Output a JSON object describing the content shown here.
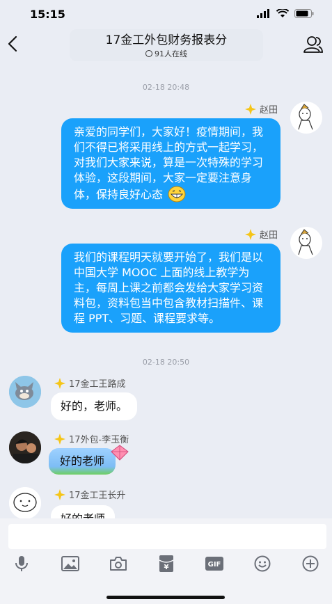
{
  "status_bar": {
    "time": "15:15"
  },
  "header": {
    "title": "17金工外包财务报表分",
    "online": "91人在线"
  },
  "messages": {
    "timestamp_1": "02-18 20:48",
    "timestamp_2": "02-18 20:50",
    "m1": {
      "sender": "赵田",
      "text": "亲爱的同学们，大家好！疫情期间，我们不得已将采用线上的方式一起学习，对我们大家来说，算是一次特殊的学习体验，这段期间，大家一定要注意身体，保持良好心态"
    },
    "m2": {
      "sender": "赵田",
      "text": "我们的课程明天就要开始了，我们是以中国大学 MOOC 上面的线上教学为主，每周上课之前都会发给大家学习资料包，资料包当中包含教材扫描件、课程 PPT、习题、课程要求等。"
    },
    "m3": {
      "sender": "17金工王路成",
      "text": "好的，老师。"
    },
    "m4": {
      "sender": "17外包-李玉衡",
      "text": "好的老师"
    },
    "m5": {
      "sender": "17金工王长升",
      "text": "好的老师"
    }
  },
  "input": {
    "value": "",
    "placeholder": ""
  },
  "toolbar": {
    "items": [
      "microphone-icon",
      "image-icon",
      "camera-icon",
      "red-packet-icon",
      "gif-icon",
      "emoji-icon",
      "plus-icon"
    ],
    "gif_label": "GIF",
    "red_packet_label": "¥"
  },
  "colors": {
    "bubble_blue": "#1aa1fb",
    "background": "#eaedf4",
    "input_bar": "#f2f3f7"
  }
}
